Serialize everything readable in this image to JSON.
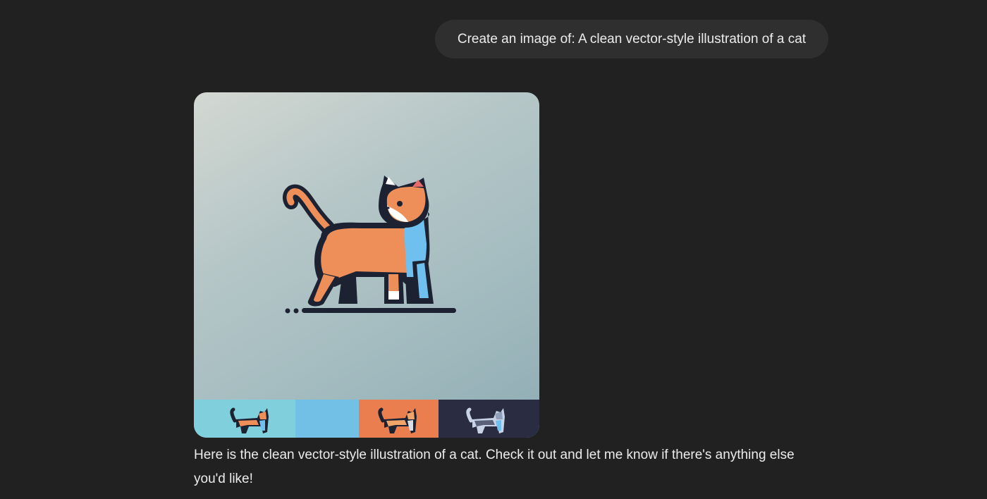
{
  "conversation": {
    "user_message": "Create an image of: A clean vector-style illustration of a cat",
    "assistant_message": "Here is the clean vector-style illustration of a cat. Check it out and let me know if there's anything else you'd like!"
  },
  "colors": {
    "background": "#212121",
    "user_bubble": "#2f2f2f",
    "text": "#ececec",
    "cat_orange": "#ee8f5a",
    "cat_blue": "#6fc0ee",
    "cat_outline": "#1d2233"
  },
  "image_variants": [
    {
      "name": "variant-teal",
      "background": "#7fd0dc",
      "has_cat": true
    },
    {
      "name": "variant-blue",
      "background": "#72c0e6",
      "has_cat": false
    },
    {
      "name": "variant-orange",
      "background": "#ea7e4e",
      "has_cat": true
    },
    {
      "name": "variant-dark",
      "background": "#2a2d42",
      "has_cat": true
    }
  ]
}
